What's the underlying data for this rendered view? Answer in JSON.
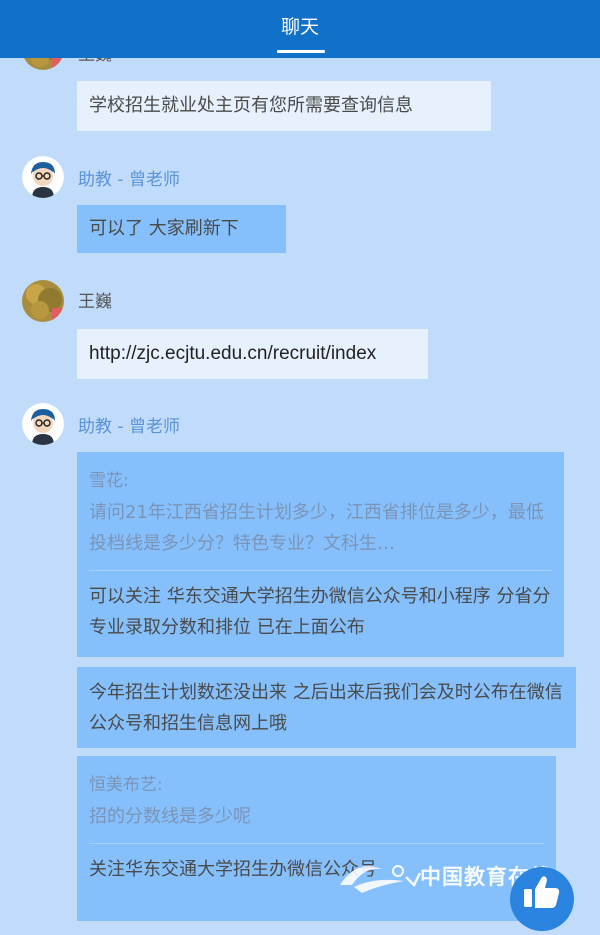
{
  "header": {
    "tab_title": "聊天"
  },
  "messages": [
    {
      "sender": "王巍",
      "text": "学校招生就业处主页有您所需要查询信息"
    },
    {
      "sender": "助教 - 曾老师",
      "text": "可以了  大家刷新下"
    },
    {
      "sender": "王巍",
      "text": "http://zjc.ecjtu.edu.cn/recruit/index"
    },
    {
      "sender": "助教 - 曾老师",
      "quote_name": "雪花:",
      "quote_text": "请问21年江西省招生计划多少，江西省排位是多少，最低投档线是多少分？特色专业？文科生…",
      "reply": "可以关注 华东交通大学招生办微信公众号和小程序  分省分专业录取分数和排位 已在上面公布"
    },
    {
      "text": "今年招生计划数还没出来   之后出来后我们会及时公布在微信公众号和招生信息网上哦"
    },
    {
      "quote_name": "恒美布艺:",
      "quote_text": "招的分数线是多少呢",
      "reply": "关注华东交通大学招生办微信公众号"
    }
  ],
  "watermark": {
    "text": "中国教育在线"
  },
  "colors": {
    "header": "#1170c8",
    "background": "#c1dcfa",
    "student_bubble": "#e6f1fd",
    "teacher_bubble": "#85c0fc",
    "teacher_name": "#5a93d6"
  },
  "icons": {
    "student_avatar": "autumn-tree-avatar",
    "teacher_avatar": "cartoon-teacher-avatar",
    "like": "thumbs-up-icon"
  }
}
